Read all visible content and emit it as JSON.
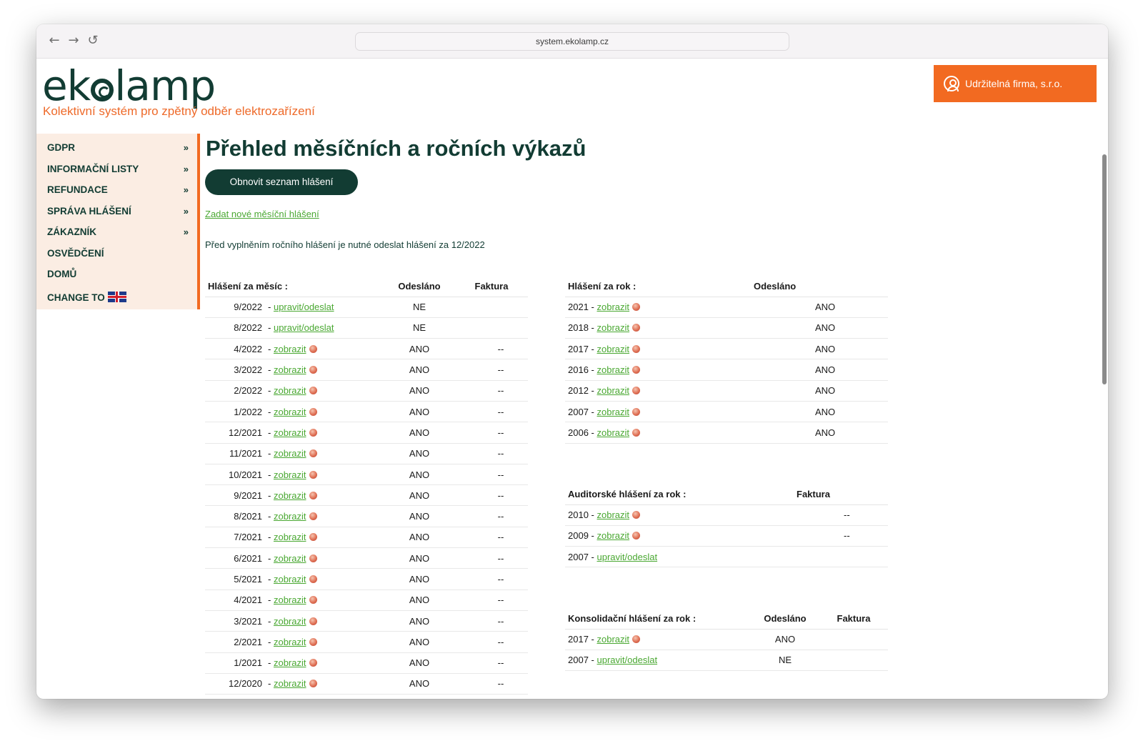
{
  "browser": {
    "url": "system.ekolamp.cz",
    "back_icon": "←",
    "forward_icon": "→",
    "reload_icon": "↺"
  },
  "header": {
    "logo_pre": "ek",
    "logo_post": "lamp",
    "tagline": "Kolektivní systém pro zpětný odběr elektrozařízení",
    "user_label": "Udržitelná firma, s.r.o."
  },
  "sidebar": {
    "items": [
      {
        "label": "GDPR",
        "chevron": "»"
      },
      {
        "label": "INFORMAČNÍ LISTY",
        "chevron": "»"
      },
      {
        "label": "REFUNDACE",
        "chevron": "»"
      },
      {
        "label": "SPRÁVA HLÁŠENÍ",
        "chevron": "»"
      },
      {
        "label": "ZÁKAZNÍK",
        "chevron": "»"
      },
      {
        "label": "OSVĚDČENÍ",
        "chevron": ""
      },
      {
        "label": "DOMŮ",
        "chevron": ""
      },
      {
        "label": "CHANGE TO",
        "chevron": ""
      }
    ]
  },
  "main": {
    "title": "Přehled měsíčních a ročních výkazů",
    "refresh_button": "Obnovit seznam hlášení",
    "new_report_link": "Zadat nové měsíční hlášení",
    "note": "Před vyplněním ročního hlášení je nutné odeslat hlášení za 12/2022"
  },
  "monthly": {
    "headers": [
      "Hlášení za měsíc :",
      "Odesláno",
      "Faktura"
    ],
    "rows": [
      {
        "period": "9/2022",
        "sep": "-",
        "action": "upravit/odeslat",
        "sent": "NE",
        "invoice": ""
      },
      {
        "period": "8/2022",
        "sep": "-",
        "action": "upravit/odeslat",
        "sent": "NE",
        "invoice": ""
      },
      {
        "period": "4/2022",
        "sep": "-",
        "action": "zobrazit",
        "sent": "ANO",
        "invoice": "--"
      },
      {
        "period": "3/2022",
        "sep": "-",
        "action": "zobrazit",
        "sent": "ANO",
        "invoice": "--"
      },
      {
        "period": "2/2022",
        "sep": "-",
        "action": "zobrazit",
        "sent": "ANO",
        "invoice": "--"
      },
      {
        "period": "1/2022",
        "sep": "-",
        "action": "zobrazit",
        "sent": "ANO",
        "invoice": "--"
      },
      {
        "period": "12/2021",
        "sep": "-",
        "action": "zobrazit",
        "sent": "ANO",
        "invoice": "--"
      },
      {
        "period": "11/2021",
        "sep": "-",
        "action": "zobrazit",
        "sent": "ANO",
        "invoice": "--"
      },
      {
        "period": "10/2021",
        "sep": "-",
        "action": "zobrazit",
        "sent": "ANO",
        "invoice": "--"
      },
      {
        "period": "9/2021",
        "sep": "-",
        "action": "zobrazit",
        "sent": "ANO",
        "invoice": "--"
      },
      {
        "period": "8/2021",
        "sep": "-",
        "action": "zobrazit",
        "sent": "ANO",
        "invoice": "--"
      },
      {
        "period": "7/2021",
        "sep": "-",
        "action": "zobrazit",
        "sent": "ANO",
        "invoice": "--"
      },
      {
        "period": "6/2021",
        "sep": "-",
        "action": "zobrazit",
        "sent": "ANO",
        "invoice": "--"
      },
      {
        "period": "5/2021",
        "sep": "-",
        "action": "zobrazit",
        "sent": "ANO",
        "invoice": "--"
      },
      {
        "period": "4/2021",
        "sep": "-",
        "action": "zobrazit",
        "sent": "ANO",
        "invoice": "--"
      },
      {
        "period": "3/2021",
        "sep": "-",
        "action": "zobrazit",
        "sent": "ANO",
        "invoice": "--"
      },
      {
        "period": "2/2021",
        "sep": "-",
        "action": "zobrazit",
        "sent": "ANO",
        "invoice": "--"
      },
      {
        "period": "1/2021",
        "sep": "-",
        "action": "zobrazit",
        "sent": "ANO",
        "invoice": "--"
      },
      {
        "period": "12/2020",
        "sep": "-",
        "action": "zobrazit",
        "sent": "ANO",
        "invoice": "--"
      }
    ]
  },
  "yearly": {
    "headers": [
      "Hlášení za rok :",
      "Odesláno"
    ],
    "rows": [
      {
        "year": "2021",
        "sep": "-",
        "action": "zobrazit",
        "sent": "ANO"
      },
      {
        "year": "2018",
        "sep": "-",
        "action": "zobrazit",
        "sent": "ANO"
      },
      {
        "year": "2017",
        "sep": "-",
        "action": "zobrazit",
        "sent": "ANO"
      },
      {
        "year": "2016",
        "sep": "-",
        "action": "zobrazit",
        "sent": "ANO"
      },
      {
        "year": "2012",
        "sep": "-",
        "action": "zobrazit",
        "sent": "ANO"
      },
      {
        "year": "2007",
        "sep": "-",
        "action": "zobrazit",
        "sent": "ANO"
      },
      {
        "year": "2006",
        "sep": "-",
        "action": "zobrazit",
        "sent": "ANO"
      }
    ]
  },
  "audit": {
    "headers": [
      "Auditorské hlášení za rok :",
      "Faktura"
    ],
    "rows": [
      {
        "year": "2010",
        "sep": "-",
        "action": "zobrazit",
        "pdf": true,
        "invoice": "--"
      },
      {
        "year": "2009",
        "sep": "-",
        "action": "zobrazit",
        "pdf": true,
        "invoice": "--"
      },
      {
        "year": "2007",
        "sep": "-",
        "action": "upravit/odeslat",
        "pdf": false,
        "invoice": ""
      }
    ]
  },
  "consolidation": {
    "headers": [
      "Konsolidační hlášení za rok :",
      "Odesláno",
      "Faktura"
    ],
    "rows": [
      {
        "year": "2017",
        "sep": "-",
        "action": "zobrazit",
        "pdf": true,
        "sent": "ANO",
        "invoice": ""
      },
      {
        "year": "2007",
        "sep": "-",
        "action": "upravit/odeslat",
        "pdf": false,
        "sent": "NE",
        "invoice": ""
      }
    ]
  },
  "colors": {
    "brand_dark": "#123c33",
    "accent_orange": "#f26a21",
    "link_green": "#4aa832",
    "sidebar_bg": "#fbede3"
  }
}
